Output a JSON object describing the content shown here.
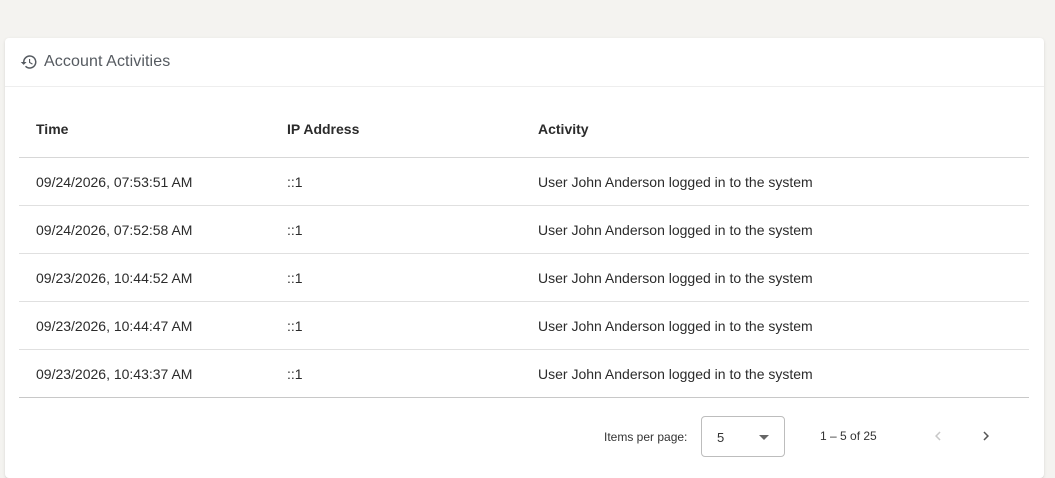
{
  "card": {
    "title": "Account Activities",
    "icon": "history-icon"
  },
  "table": {
    "columns": [
      "Time",
      "IP Address",
      "Activity"
    ],
    "rows": [
      {
        "time": "09/24/2026, 07:53:51 AM",
        "ip": "::1",
        "activity": "User John Anderson logged in to the system"
      },
      {
        "time": "09/24/2026, 07:52:58 AM",
        "ip": "::1",
        "activity": "User John Anderson logged in to the system"
      },
      {
        "time": "09/23/2026, 10:44:52 AM",
        "ip": "::1",
        "activity": "User John Anderson logged in to the system"
      },
      {
        "time": "09/23/2026, 10:44:47 AM",
        "ip": "::1",
        "activity": "User John Anderson logged in to the system"
      },
      {
        "time": "09/23/2026, 10:43:37 AM",
        "ip": "::1",
        "activity": "User John Anderson logged in to the system"
      }
    ]
  },
  "paginator": {
    "items_per_page_label": "Items per page:",
    "items_per_page_value": "5",
    "range_label": "1 – 5 of 25",
    "prev_icon": "chevron-left-icon",
    "next_icon": "chevron-right-icon"
  },
  "colors": {
    "background": "#f4f3f0",
    "card": "#ffffff",
    "title_text": "#555a60",
    "disabled_nav": "#c8c8c8",
    "enabled_nav": "#555555"
  }
}
